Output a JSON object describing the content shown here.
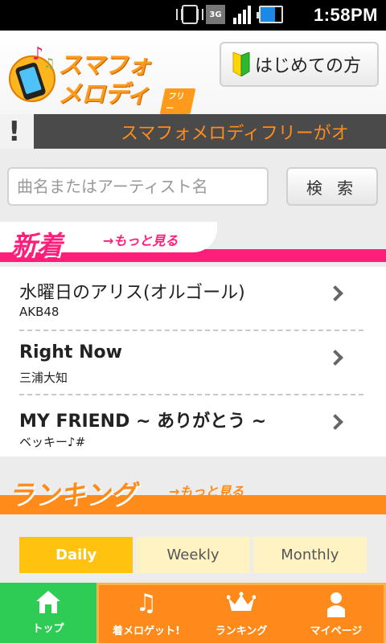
{
  "status_bar": {
    "time": "1:58PM",
    "network": "3G",
    "icons": [
      "vibrate-icon",
      "3g-icon",
      "signal-icon",
      "battery-icon"
    ]
  },
  "header": {
    "logo_line1": "スマフォ",
    "logo_line2": "メロディ",
    "logo_badge": "フリー",
    "beginner_button": "はじめての方",
    "beginner_icon": "beginner-mark-icon"
  },
  "ticker": {
    "text": "スマフォメロディフリーがオ"
  },
  "search": {
    "placeholder": "曲名またはアーティスト名",
    "button": "検 索"
  },
  "new_section": {
    "title": "新着",
    "more": "→もっと見る",
    "items": [
      {
        "title": "水曜日のアリス(オルゴール)",
        "artist": "AKB48"
      },
      {
        "title": "Right Now",
        "artist": "三浦大知"
      },
      {
        "title": "MY FRIEND ~ ありがとう ~",
        "artist": "ベッキー♪#"
      }
    ]
  },
  "ranking_section": {
    "title": "ランキング",
    "more": "→もっと見る",
    "tabs": [
      "Daily",
      "Weekly",
      "Monthly"
    ],
    "active_tab": "Daily"
  },
  "bottom_nav": {
    "items": [
      {
        "label": "トップ",
        "icon": "home-icon"
      },
      {
        "label": "着メロゲット!",
        "icon": "music-note-icon"
      },
      {
        "label": "ランキング",
        "icon": "crown-icon"
      },
      {
        "label": "マイページ",
        "icon": "person-icon"
      }
    ]
  },
  "colors": {
    "accent_orange": "#ff8c1a",
    "accent_pink": "#ff1f7a",
    "nav_green": "#2ecc55",
    "tab_active": "#ffc20e"
  }
}
